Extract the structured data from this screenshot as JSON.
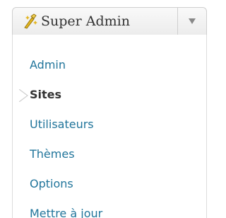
{
  "header": {
    "title": "Super Admin",
    "icon": "magic-wand-icon",
    "toggle_icon": "chevron-down-icon"
  },
  "menu": {
    "items": [
      {
        "label": "Admin",
        "current": false
      },
      {
        "label": "Sites",
        "current": true
      },
      {
        "label": "Utilisateurs",
        "current": false
      },
      {
        "label": "Thèmes",
        "current": false
      },
      {
        "label": "Options",
        "current": false
      },
      {
        "label": "Mettre à jour",
        "current": false
      }
    ]
  },
  "colors": {
    "link": "#21759b",
    "current": "#333333",
    "border": "#cfcfcf",
    "header_bg": "#ececec",
    "wand_yellow": "#e3b51f"
  }
}
